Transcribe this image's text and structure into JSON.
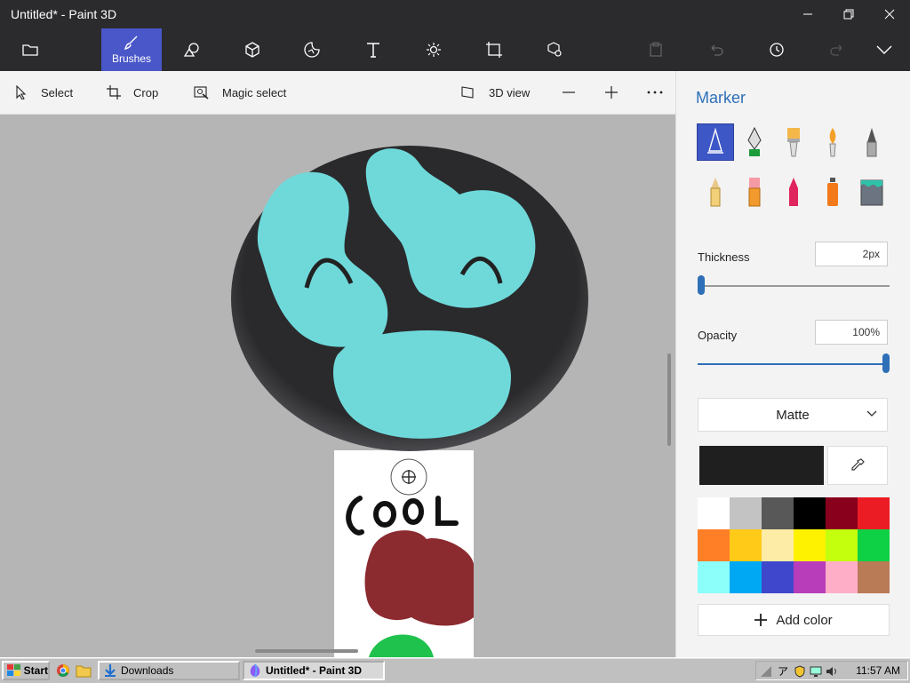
{
  "window": {
    "title": "Untitled* - Paint 3D"
  },
  "toolbar": {
    "tools": [
      {
        "name": "menu",
        "label": "",
        "icon": "folder-icon"
      },
      {
        "name": "brushes",
        "label": "Brushes",
        "icon": "brush-icon",
        "active": true
      },
      {
        "name": "2d-shapes",
        "label": "",
        "icon": "2d-shapes-icon"
      },
      {
        "name": "3d-shapes",
        "label": "",
        "icon": "cube-icon"
      },
      {
        "name": "stickers",
        "label": "",
        "icon": "sticker-icon"
      },
      {
        "name": "text",
        "label": "",
        "icon": "text-icon"
      },
      {
        "name": "effects",
        "label": "",
        "icon": "sun-icon"
      },
      {
        "name": "canvas",
        "label": "",
        "icon": "canvas-icon"
      },
      {
        "name": "3d-library",
        "label": "",
        "icon": "3d-library-icon"
      }
    ]
  },
  "commands": {
    "select": "Select",
    "crop": "Crop",
    "magic_select": "Magic select",
    "view3d": "3D view"
  },
  "canvas_art": {
    "text": "COOL"
  },
  "panel": {
    "title": "Marker",
    "brushes": [
      "marker-icon",
      "calligraphy-pen-icon",
      "oil-brush-icon",
      "watercolor-icon",
      "pixel-pen-icon",
      "pencil-icon",
      "eraser-icon",
      "crayon-icon",
      "spray-can-icon",
      "fill-bucket-icon"
    ],
    "thickness_label": "Thickness",
    "thickness_value": "2px",
    "thickness_fraction": 0.02,
    "opacity_label": "Opacity",
    "opacity_value": "100%",
    "opacity_fraction": 1.0,
    "finish": "Matte",
    "current_color": "#1f1f1f",
    "palette": [
      "#ffffff",
      "#c3c3c3",
      "#585858",
      "#000000",
      "#88001b",
      "#ec1c24",
      "#ff7f27",
      "#ffca18",
      "#fdeca6",
      "#fff200",
      "#c4ff0e",
      "#0ed145",
      "#8cfffb",
      "#00a8f3",
      "#3f48cc",
      "#b83dba",
      "#ffaec8",
      "#b97a56"
    ],
    "add_color": "Add color"
  },
  "taskbar": {
    "start": "Start",
    "downloads": "Downloads",
    "paint_window": "Untitled* - Paint 3D",
    "clock": "11:57 AM"
  }
}
